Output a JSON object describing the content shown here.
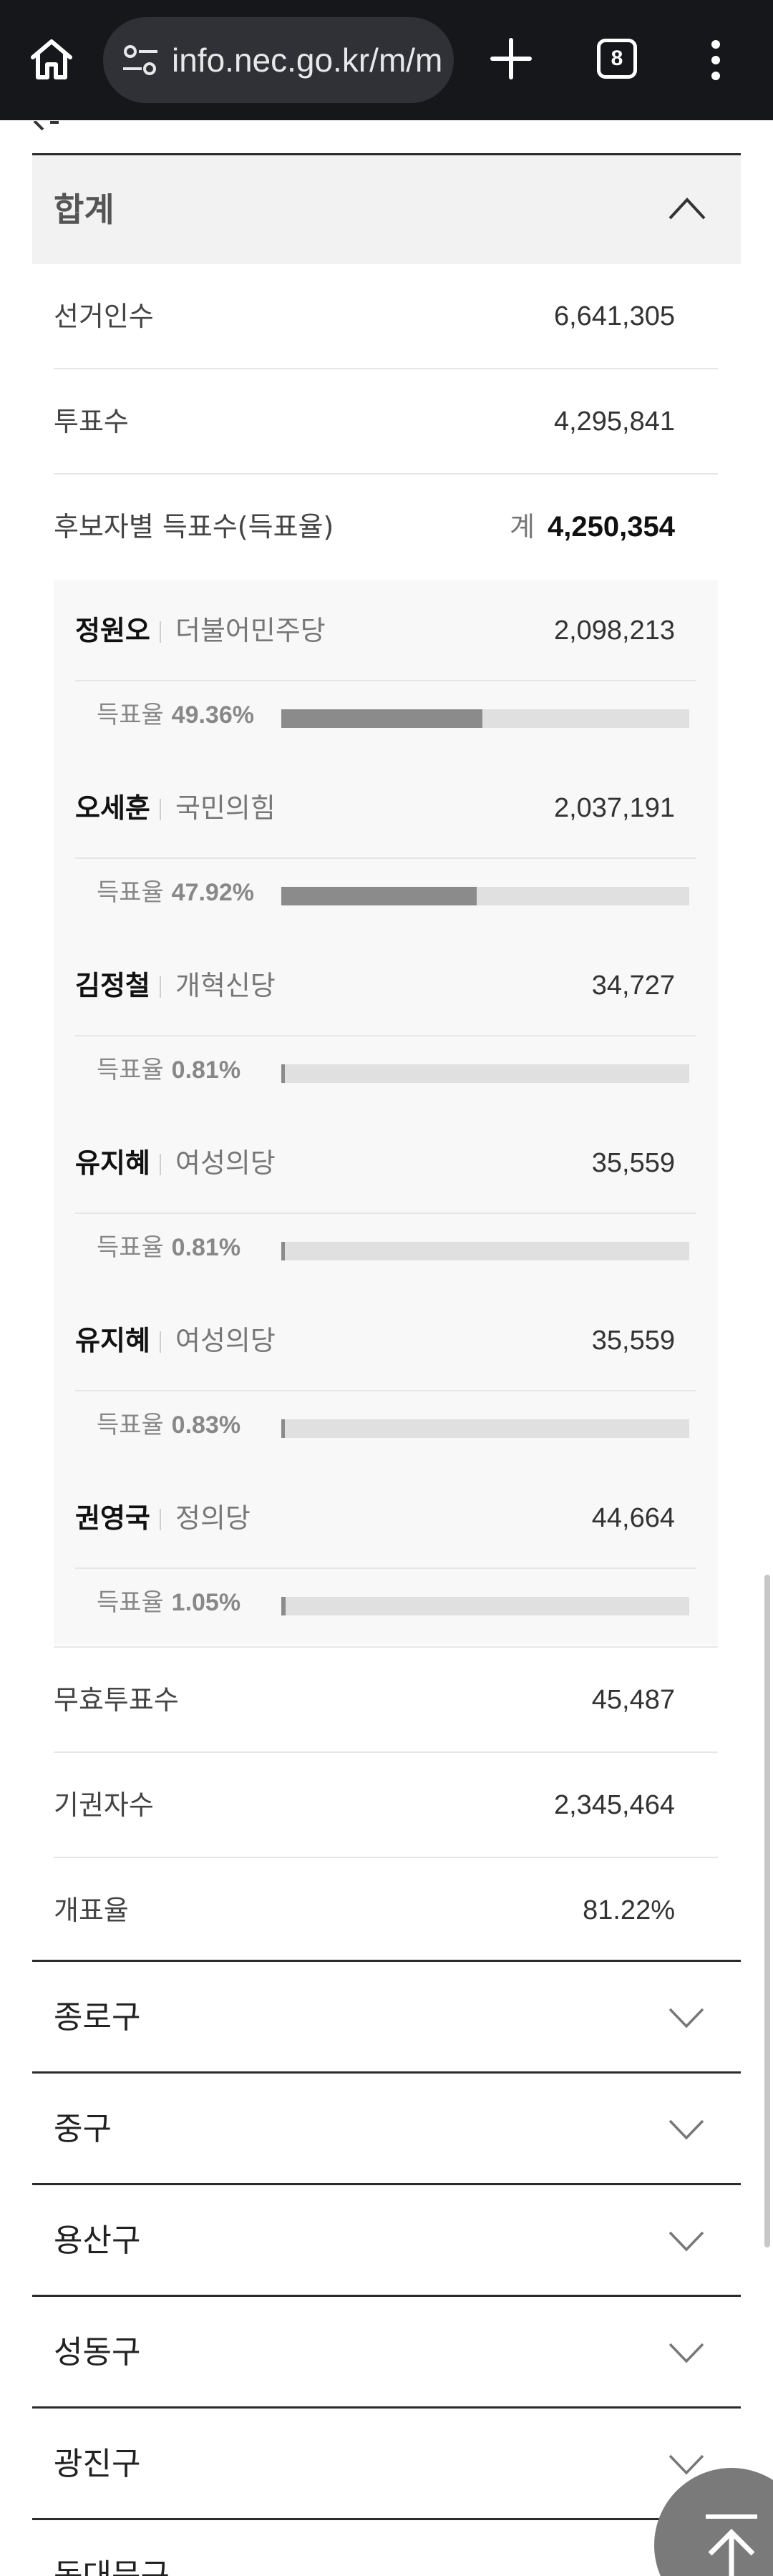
{
  "browser": {
    "url": "info.nec.go.kr/m/main/main.xhtml",
    "tab_count": "8",
    "icons": [
      "home-icon",
      "site-settings-icon",
      "plus-icon",
      "tab-switcher-icon",
      "more-vert-icon"
    ]
  },
  "summary": {
    "title": "합계",
    "rows": {
      "electors": {
        "label": "선거인수",
        "value": "6,641,305"
      },
      "ballots": {
        "label": "투표수",
        "value": "4,295,841"
      },
      "by_candidate": {
        "label": "후보자별 득표수(득표율)",
        "prefix": "계",
        "value": "4,250,354"
      },
      "invalid": {
        "label": "무효투표수",
        "value": "45,487"
      },
      "abstain": {
        "label": "기권자수",
        "value": "2,345,464"
      },
      "count_rate": {
        "label": "개표율",
        "value": "81.22%"
      }
    }
  },
  "candidates": [
    {
      "name": "정원오",
      "party": "더불어민주당",
      "votes": "2,098,213",
      "rate_label": "득표율",
      "rate": "49.36%",
      "rate_value": 49.36
    },
    {
      "name": "오세훈",
      "party": "국민의힘",
      "votes": "2,037,191",
      "rate_label": "득표율",
      "rate": "47.92%",
      "rate_value": 47.92
    },
    {
      "name": "김정철",
      "party": "개혁신당",
      "votes": "34,727",
      "rate_label": "득표율",
      "rate": "0.81%",
      "rate_value": 0.81
    },
    {
      "name": "유지혜",
      "party": "여성의당",
      "votes": "35,559",
      "rate_label": "득표율",
      "rate": "0.81%",
      "rate_value": 0.81
    },
    {
      "name": "유지혜",
      "party": "여성의당",
      "votes": "35,559",
      "rate_label": "득표율",
      "rate": "0.83%",
      "rate_value": 0.83
    },
    {
      "name": "권영국",
      "party": "정의당",
      "votes": "44,664",
      "rate_label": "득표율",
      "rate": "1.05%",
      "rate_value": 1.05
    }
  ],
  "districts": [
    "종로구",
    "중구",
    "용산구",
    "성동구",
    "광진구",
    "동대문구"
  ],
  "colors": {
    "bar_fill": "#8b8b8b",
    "bar_track": "#e0e0e0",
    "header_bg": "#f2f2f2",
    "topbar_bg": "#16171b"
  }
}
